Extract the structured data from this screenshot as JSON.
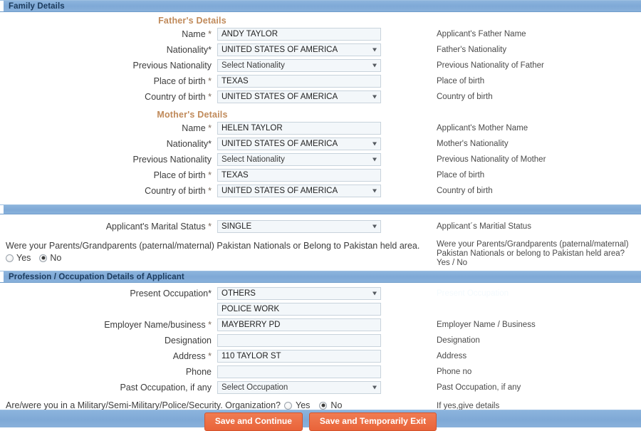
{
  "sections": {
    "family": {
      "title": "Family Details",
      "father_heading": "Father's Details",
      "mother_heading": "Mother's Details"
    },
    "profession": {
      "title": "Profession / Occupation Details of Applicant"
    }
  },
  "father": {
    "rows": [
      {
        "label": "Name",
        "required": "*",
        "type": "text",
        "value": "ANDY TAYLOR",
        "hint": "Applicant's Father Name"
      },
      {
        "label": "Nationality*",
        "required": "",
        "type": "select",
        "value": "UNITED STATES OF AMERICA",
        "hint": "Father's Nationality"
      },
      {
        "label": "Previous Nationality",
        "required": "",
        "type": "select",
        "value": "Select Nationality",
        "hint": "Previous Nationality of Father"
      },
      {
        "label": "Place of birth",
        "required": "*",
        "type": "text",
        "value": "TEXAS",
        "hint": "Place of birth"
      },
      {
        "label": "Country of birth",
        "required": "*",
        "type": "select",
        "value": "UNITED STATES OF AMERICA",
        "hint": "Country of birth"
      }
    ]
  },
  "mother": {
    "rows": [
      {
        "label": "Name",
        "required": "*",
        "type": "text",
        "value": "HELEN TAYLOR",
        "hint": "Applicant's Mother Name"
      },
      {
        "label": "Nationality*",
        "required": "",
        "type": "select",
        "value": "UNITED STATES OF AMERICA",
        "hint": "Mother's Nationality"
      },
      {
        "label": "Previous Nationality",
        "required": "",
        "type": "select",
        "value": "Select Nationality",
        "hint": "Previous Nationality of Mother"
      },
      {
        "label": "Place of birth",
        "required": "*",
        "type": "text",
        "value": "TEXAS",
        "hint": "Place of birth"
      },
      {
        "label": "Country of birth",
        "required": "*",
        "type": "select",
        "value": "UNITED STATES OF AMERICA",
        "hint": "Country of birth"
      }
    ]
  },
  "marital": {
    "label": "Applicant's Marital Status",
    "required": "*",
    "value": "SINGLE",
    "hint": "Applicant´s Maritial Status",
    "question": "Were your Parents/Grandparents (paternal/maternal) Pakistan Nationals or Belong to Pakistan held area.",
    "question_hint": "Were your Parents/Grandparents (paternal/maternal) Pakistan Nationals or belong to Pakistan held area? Yes / No",
    "yes_label": "Yes",
    "no_label": "No",
    "selected": "No"
  },
  "profession": {
    "present_occupation_label": "Present Occupation*",
    "present_occupation_value": "OTHERS",
    "present_occupation_other_value": "POLICE WORK",
    "present_occupation_hint": "Present Occupation",
    "rows": [
      {
        "label": "Employer Name/business",
        "required": "*",
        "type": "text",
        "value": "MAYBERRY PD",
        "placeholder": "",
        "hint": "Employer Name / Business"
      },
      {
        "label": "Designation",
        "required": "",
        "type": "text",
        "value": "",
        "placeholder": "",
        "hint": "Designation"
      },
      {
        "label": "Address",
        "required": "*",
        "type": "text",
        "value": "110 TAYLOR ST",
        "placeholder": "",
        "hint": "Address"
      },
      {
        "label": "Phone",
        "required": "",
        "type": "text",
        "value": "",
        "placeholder": "",
        "hint": "Phone no"
      },
      {
        "label": "Past Occupation, if any",
        "required": "",
        "type": "select",
        "value": "Select Occupation",
        "placeholder": "",
        "hint": "Past Occupation, if any"
      }
    ],
    "military_question": "Are/were you in a Military/Semi-Military/Police/Security. Organization?",
    "military_yes": "Yes",
    "military_no": "No",
    "military_selected": "No",
    "military_hint": "If yes,give details"
  },
  "footer": {
    "save_continue_label": "Save and Continue",
    "save_exit_label": "Save and Temporarily Exit"
  },
  "colors": {
    "bar_blue": "#7fa9d6",
    "bar_title": "#1b3a5c",
    "sub_heading": "#c08a5a",
    "button_orange": "#e9643a",
    "field_bg": "#f3f7fa",
    "field_border": "#c8d3dc"
  }
}
